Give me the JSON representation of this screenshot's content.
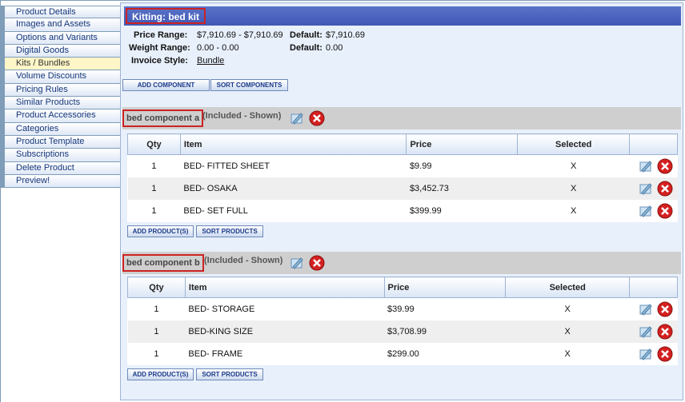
{
  "sidebar": {
    "items": [
      {
        "label": "Product Details",
        "active": false
      },
      {
        "label": "Images and Assets",
        "active": false
      },
      {
        "label": "Options and Variants",
        "active": false
      },
      {
        "label": "Digital Goods",
        "active": false
      },
      {
        "label": "Kits / Bundles",
        "active": true
      },
      {
        "label": "Volume Discounts",
        "active": false
      },
      {
        "label": "Pricing Rules",
        "active": false
      },
      {
        "label": "Similar Products",
        "active": false
      },
      {
        "label": "Product Accessories",
        "active": false
      },
      {
        "label": "Categories",
        "active": false
      },
      {
        "label": "Product Template",
        "active": false
      },
      {
        "label": "Subscriptions",
        "active": false
      },
      {
        "label": "Delete Product",
        "active": false
      },
      {
        "label": "Preview!",
        "active": false
      }
    ]
  },
  "header": {
    "title": "Kitting: bed kit"
  },
  "info": {
    "price_range_label": "Price Range:",
    "price_range_value": "$7,910.69 - $7,910.69",
    "price_default_label": "Default:",
    "price_default_value": "$7,910.69",
    "weight_range_label": "Weight Range:",
    "weight_range_value": "0.00 - 0.00",
    "weight_default_label": "Default:",
    "weight_default_value": "0.00",
    "invoice_style_label": "Invoice Style:",
    "invoice_style_value": "Bundle"
  },
  "toolbar": {
    "add_component": "ADD COMPONENT",
    "sort_components": "SORT COMPONENTS"
  },
  "components": [
    {
      "name": "bed component a",
      "status": "(Included - Shown)",
      "columns": {
        "qty": "Qty",
        "item": "Item",
        "price": "Price",
        "selected": "Selected"
      },
      "rows": [
        {
          "qty": "1",
          "item": "BED- FITTED SHEET",
          "price": "$9.99",
          "selected": "X"
        },
        {
          "qty": "1",
          "item": "BED- OSAKA",
          "price": "$3,452.73",
          "selected": "X"
        },
        {
          "qty": "1",
          "item": "BED- SET FULL",
          "price": "$399.99",
          "selected": "X"
        }
      ],
      "add_products": "ADD PRODUCT(S)",
      "sort_products": "SORT PRODUCTS"
    },
    {
      "name": "bed component b",
      "status": "(Included - Shown)",
      "columns": {
        "qty": "Qty",
        "item": "Item",
        "price": "Price",
        "selected": "Selected"
      },
      "rows": [
        {
          "qty": "1",
          "item": "BED- STORAGE",
          "price": "$39.99",
          "selected": "X"
        },
        {
          "qty": "1",
          "item": "BED-KING SIZE",
          "price": "$3,708.99",
          "selected": "X"
        },
        {
          "qty": "1",
          "item": "BED- FRAME",
          "price": "$299.00",
          "selected": "X"
        }
      ],
      "add_products": "ADD PRODUCT(S)",
      "sort_products": "SORT PRODUCTS"
    }
  ],
  "colors": {
    "title_bar": "#4a62bd",
    "highlight_border": "#cc2222",
    "delete_red": "#d42020"
  }
}
